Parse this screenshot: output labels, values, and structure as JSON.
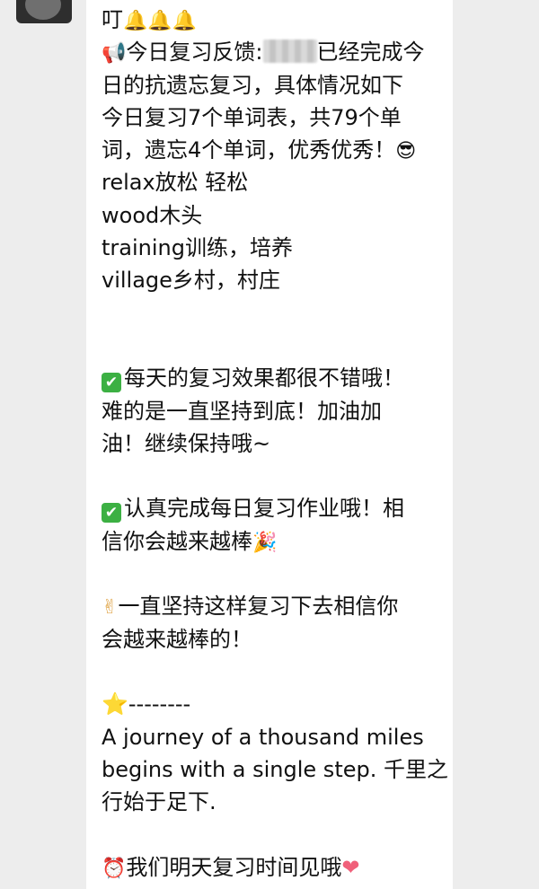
{
  "chat": {
    "lines": [
      {
        "parts": [
          "叮",
          "🔔",
          "🔔",
          "🔔"
        ]
      },
      {
        "prefix_icon": "📢",
        "before": "今日复习反馈:",
        "after": "已经完成今"
      },
      {
        "text": "日的抗遗忘复习，具体情况如下"
      },
      {
        "text": "今日复习7个单词表，共79个单"
      },
      {
        "text": "词，遗忘4个单词，优秀优秀！",
        "suffix_icon": "😎"
      },
      {
        "text": "relax放松 轻松"
      },
      {
        "text": "wood木头"
      },
      {
        "text": "training训练，培养"
      },
      {
        "text": "village乡村，村庄"
      },
      {
        "text": ""
      },
      {
        "text": ""
      },
      {
        "prefix_icon": "✔",
        "text": "每天的复习效果都很不错哦！"
      },
      {
        "text": "难的是一直坚持到底！加油加"
      },
      {
        "text": "油！继续保持哦~"
      },
      {
        "text": ""
      },
      {
        "prefix_icon": "✔",
        "text": "认真完成每日复习作业哦！相"
      },
      {
        "text": "信你会越来越棒",
        "suffix_icon": "🎉"
      },
      {
        "text": ""
      },
      {
        "prefix_icon": "✌",
        "text": "一直坚持这样复习下去相信你"
      },
      {
        "text": "会越来越棒的！"
      },
      {
        "text": ""
      },
      {
        "prefix_icon": "⭐",
        "text": "--------"
      },
      {
        "text": "A journey of a thousand miles"
      },
      {
        "text": "begins with a single step. 千里之"
      },
      {
        "text": "行始于足下."
      },
      {
        "text": ""
      },
      {
        "prefix_icon": "⏰",
        "text": "我们明天复习时间见哦",
        "suffix_icon": "❤"
      }
    ]
  }
}
